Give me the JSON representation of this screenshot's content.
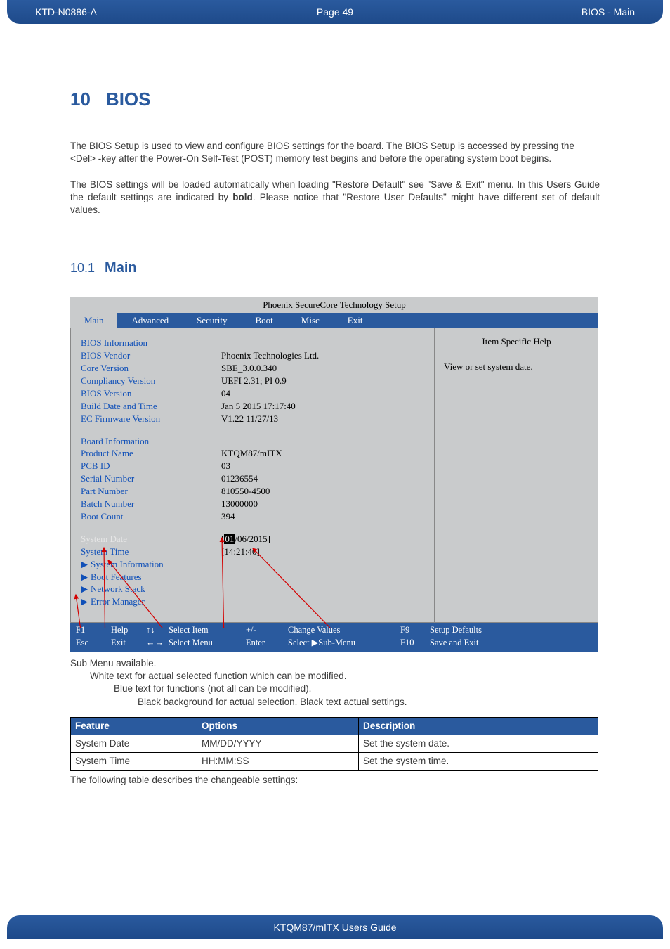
{
  "header": {
    "left": "KTD-N0886-A",
    "center": "Page 49",
    "right": "BIOS  - Main"
  },
  "heading": {
    "num": "10",
    "title": "BIOS"
  },
  "para1": "The BIOS Setup is used to view and configure BIOS settings for the board. The BIOS Setup is accessed by pressing the <Del> -key after the Power-On Self-Test (POST) memory test begins and before the operating system boot begins.",
  "para2a": "The BIOS settings will be loaded automatically when loading \"Restore Default\" see \"Save & Exit\" menu. In this Users Guide the default settings are indicated by ",
  "para2b": "bold",
  "para2c": ". Please notice that \"Restore User Defaults\" might have different set of default values.",
  "subheading": {
    "num": "10.1",
    "title": "Main"
  },
  "bios": {
    "title": "Phoenix SecureCore Technology Setup",
    "tabs": [
      "Main",
      "Advanced",
      "Security",
      "Boot",
      "Misc",
      "Exit"
    ],
    "section1": "BIOS Information",
    "rows1": [
      {
        "lbl": "BIOS Vendor",
        "val": "Phoenix Technologies Ltd."
      },
      {
        "lbl": "Core Version",
        "val": "SBE_3.0.0.340"
      },
      {
        "lbl": "Compliancy Version",
        "val": "UEFI 2.31;  PI 0.9"
      },
      {
        "lbl": "BIOS Version",
        "val": "04"
      },
      {
        "lbl": "Build Date and Time",
        "val": "Jan 5 2015 17:17:40"
      },
      {
        "lbl": "EC Firmware Version",
        "val": "V1.22 11/27/13"
      }
    ],
    "section2": "Board Information",
    "rows2": [
      {
        "lbl": "Product Name",
        "val": "KTQM87/mITX"
      },
      {
        "lbl": "PCB ID",
        "val": "03"
      },
      {
        "lbl": "Serial Number",
        "val": "01236554"
      },
      {
        "lbl": "Part Number",
        "val": "810550-4500"
      },
      {
        "lbl": "Batch Number",
        "val": "13000000"
      },
      {
        "lbl": "Boot Count",
        "val": "394"
      }
    ],
    "sysdate_lbl": "System Date",
    "sysdate_hi": "01",
    "sysdate_rest": "/06/2015]",
    "systime_lbl": "System Time",
    "systime_val": "[14:21:40]",
    "submenus": [
      "System Information",
      "Boot Features",
      "Network Stack",
      "Error Manager"
    ],
    "help_title": "Item Specific Help",
    "help_text": "View or set system date.",
    "footer": {
      "r1": [
        "F1",
        "Help",
        "↑↓",
        "Select Item",
        "+/-",
        "Change Values",
        "F9",
        "Setup Defaults"
      ],
      "r2": [
        "Esc",
        "Exit",
        "←→",
        "Select Menu",
        "Enter",
        "Select ▶Sub-Menu",
        "F10",
        "Save and Exit"
      ]
    }
  },
  "legend": {
    "l0": "Sub Menu available.",
    "l1": "White text for actual selected function which can be modified.",
    "l2": "Blue text for functions (not all can be modified).",
    "l3": "Black background for actual selection. Black text actual settings."
  },
  "table": {
    "headers": [
      "Feature",
      "Options",
      "Description"
    ],
    "rows": [
      [
        "System Date",
        "MM/DD/YYYY",
        "Set the system date."
      ],
      [
        "System Time",
        "HH:MM:SS",
        "Set the system time."
      ]
    ]
  },
  "note_after": "The following table describes the changeable settings:",
  "footer": "KTQM87/mITX Users Guide"
}
